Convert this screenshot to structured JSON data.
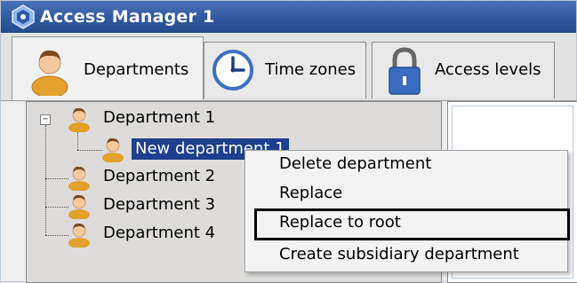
{
  "window": {
    "title": "Access Manager 1"
  },
  "tabs": [
    {
      "label": "Departments",
      "icon": "user-icon",
      "active": true
    },
    {
      "label": "Time zones",
      "icon": "clock-icon",
      "active": false
    },
    {
      "label": "Access levels",
      "icon": "lock-icon",
      "active": false
    }
  ],
  "tree": {
    "nodes": [
      {
        "label": "Department 1",
        "level": 0,
        "expanded": true
      },
      {
        "label": "New department 1",
        "level": 1,
        "selected": true
      },
      {
        "label": "Department 2",
        "level": 0
      },
      {
        "label": "Department 3",
        "level": 0
      },
      {
        "label": "Department 4",
        "level": 0
      }
    ]
  },
  "context_menu": {
    "items": [
      {
        "label": "Delete department"
      },
      {
        "label": "Replace"
      },
      {
        "label": "Replace to root",
        "highlighted": true
      },
      {
        "label": "Create subsidiary department"
      }
    ]
  },
  "colors": {
    "titlebar": "#2f5a9f",
    "selection": "#1d3f8e",
    "user_icon": "#e0a02a"
  }
}
